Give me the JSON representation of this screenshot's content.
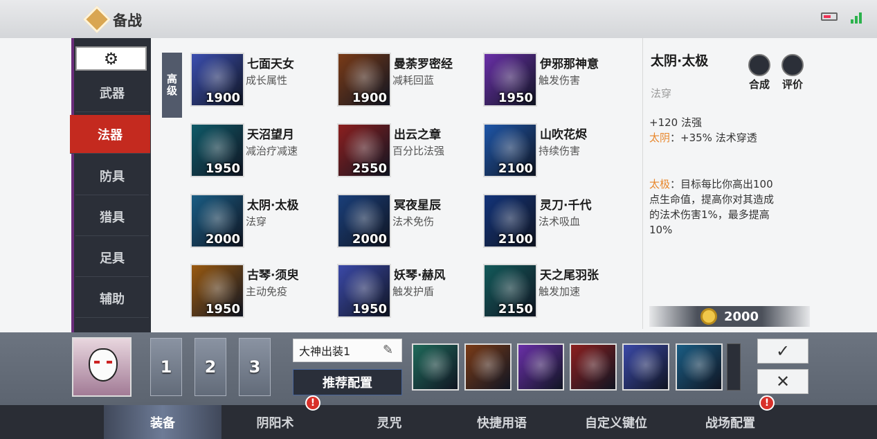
{
  "header": {
    "title": "备战"
  },
  "categories": {
    "settings_icon": "gear-icon",
    "items": [
      "武器",
      "法器",
      "防具",
      "猎具",
      "足具",
      "辅助"
    ],
    "active": "法器"
  },
  "tier_label": "高级",
  "items": [
    {
      "name": "七面天女",
      "desc": "成长属性",
      "price": "1900",
      "color": "#3c4fb0"
    },
    {
      "name": "曼荼罗密经",
      "desc": "减耗回蓝",
      "price": "1900",
      "color": "#7a3b17"
    },
    {
      "name": "伊邪那神意",
      "desc": "触发伤害",
      "price": "1950",
      "color": "#6a2fa8"
    },
    {
      "name": "天沼望月",
      "desc": "减治疗减速",
      "price": "1950",
      "color": "#0f5a68"
    },
    {
      "name": "出云之章",
      "desc": "百分比法强",
      "price": "2550",
      "color": "#8c1f1f"
    },
    {
      "name": "山吹花烬",
      "desc": "持续伤害",
      "price": "2100",
      "color": "#1e56a8"
    },
    {
      "name": "太阴·太极",
      "desc": "法穿",
      "price": "2000",
      "color": "#1a5d84"
    },
    {
      "name": "冥夜星辰",
      "desc": "法术免伤",
      "price": "2000",
      "color": "#1a3f7a"
    },
    {
      "name": "灵刀·千代",
      "desc": "法术吸血",
      "price": "2100",
      "color": "#13347a"
    },
    {
      "name": "古琴·须臾",
      "desc": "主动免疫",
      "price": "1950",
      "color": "#9a5a10"
    },
    {
      "name": "妖琴·赫风",
      "desc": "触发护盾",
      "price": "1950",
      "color": "#3b49a8"
    },
    {
      "name": "天之尾羽张",
      "desc": "触发加速",
      "price": "2150",
      "color": "#135a5a"
    }
  ],
  "detail": {
    "title": "太阴·太极",
    "subtitle": "法穿",
    "compose_label": "合成",
    "review_label": "评价",
    "stat_line": "+120 法强",
    "passive1_name": "太阴",
    "passive1_text": "：+35% 法术穿透",
    "passive2_name": "太极",
    "passive2_text": "：目标每比你高出100点生命值，提高你对其造成的法术伤害1%，最多提高10%",
    "price": "2000"
  },
  "loadout": {
    "slots": [
      "1",
      "2",
      "3"
    ],
    "build_name": "大神出装1",
    "recommend_label": "推荐配置",
    "equipped_colors": [
      "#1f6a5a",
      "#7a3b17",
      "#6a2fa8",
      "#8c1f1f",
      "#3b49a8",
      "#1a5d84"
    ]
  },
  "tabs": {
    "items": [
      "装备",
      "阴阳术",
      "灵咒",
      "快捷用语",
      "自定义键位",
      "战场配置"
    ],
    "active": "装备",
    "badge": "!"
  }
}
